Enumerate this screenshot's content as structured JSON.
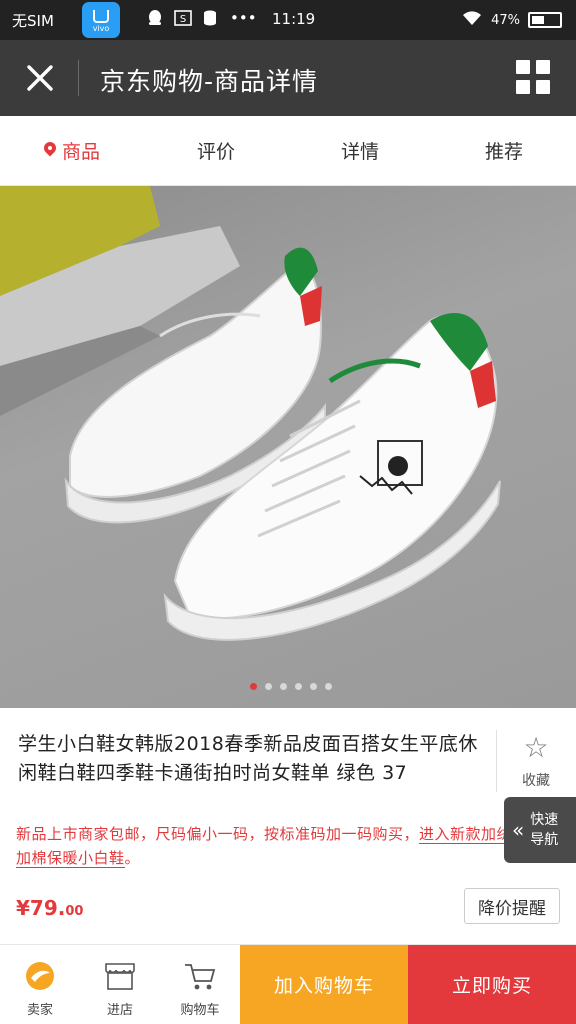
{
  "status_bar": {
    "carrier": "无SIM",
    "vivo_label": "vivo",
    "icons": [
      "qq-icon",
      "sim-icon",
      "database-icon",
      "more-icon"
    ],
    "more": "•••",
    "time": "11:19",
    "battery_percent": "47%"
  },
  "header": {
    "title": "京东购物-商品详情"
  },
  "tabs": [
    {
      "label": "商品",
      "active": true
    },
    {
      "label": "评价",
      "active": false
    },
    {
      "label": "详情",
      "active": false
    },
    {
      "label": "推荐",
      "active": false
    }
  ],
  "gallery": {
    "image_count": 6,
    "current_index": 0
  },
  "product": {
    "title": "学生小白鞋女韩版2018春季新品皮面百搭女生平底休闲鞋白鞋四季鞋卡通街拍时尚女鞋单 绿色 37",
    "favorite_label": "收藏",
    "promo_text": "新品上市商家包邮，尺码偏小一码，按标准码加一码购买，",
    "promo_link": "进入新款加绒加棉保暖小白鞋",
    "promo_end": "。",
    "price_main": "¥79.",
    "price_cents": "00",
    "price_alert_label": "降价提醒",
    "quick_nav_label_1": "快速",
    "quick_nav_label_2": "导航"
  },
  "bottom_bar": {
    "store_label": "卖家",
    "shop_label": "进店",
    "cart_label": "购物车",
    "add_to_cart": "加入购物车",
    "buy_now": "立即购买"
  },
  "colors": {
    "accent_red": "#e4393c",
    "orange": "#f6a623",
    "dark_header": "#3b3b3b"
  }
}
